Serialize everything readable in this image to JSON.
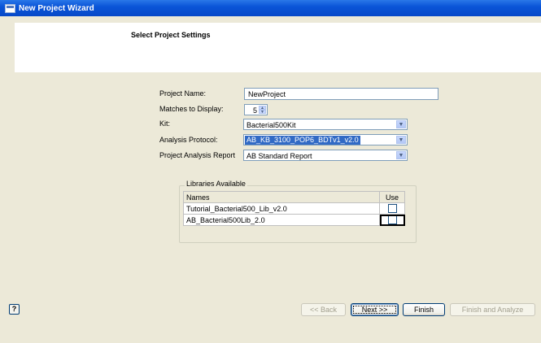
{
  "window": {
    "title": "New Project Wizard"
  },
  "header": {
    "title": "Select Project Settings"
  },
  "form": {
    "project_name_label": "Project Name:",
    "project_name_value": "NewProject",
    "matches_label": "Matches to Display:",
    "matches_value": "5",
    "kit_label": "Kit:",
    "kit_value": "Bacterial500Kit",
    "protocol_label": "Analysis Protocol:",
    "protocol_value": "AB_KB_3100_POP6_BDTv1_v2.0",
    "report_label": "Project Analysis Report",
    "report_value": "AB Standard Report"
  },
  "libraries": {
    "group_label": "Libraries Available",
    "columns": [
      "Names",
      "Use"
    ],
    "rows": [
      {
        "name": "Tutorial_Bacterial500_Lib_v2.0",
        "use": false
      },
      {
        "name": "AB_Bacterial500Lib_2.0",
        "use": false
      }
    ]
  },
  "footer": {
    "help_label": "?",
    "back_label": "<< Back",
    "next_label": "Next >>",
    "finish_label": "Finish",
    "finish_analyze_label": "Finish and Analyze"
  },
  "colors": {
    "titlebar": "#0a55d8",
    "selection": "#316ac5",
    "background": "#ece9d8"
  },
  "icons": {
    "combo_arrow": "chevron-down-icon",
    "spinner": "spinner-arrows-icon",
    "app": "wizard-app-icon"
  }
}
